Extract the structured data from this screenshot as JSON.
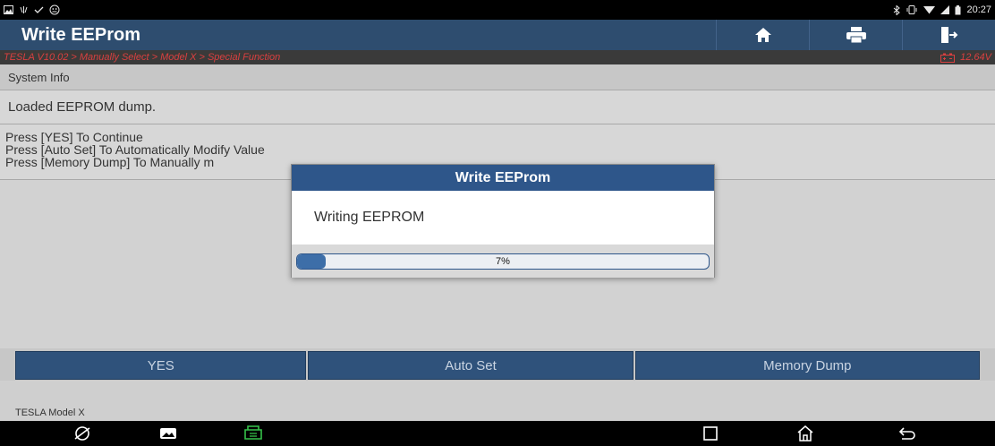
{
  "status_bar": {
    "time": "20:27",
    "left_icons": [
      "image-icon",
      "usb-icon",
      "check-icon",
      "android-icon"
    ],
    "right_icons": [
      "bluetooth-icon",
      "vibrate-icon",
      "wifi-icon",
      "signal-icon",
      "battery-icon"
    ]
  },
  "header": {
    "title": "Write EEProm",
    "buttons": [
      "home-icon",
      "print-icon",
      "exit-icon"
    ]
  },
  "breadcrumb": {
    "path": "TESLA V10.02 > Manually Select > Model X > Special Function",
    "voltage": "12.64V"
  },
  "section": {
    "title": "System Info"
  },
  "message": {
    "text": "Loaded EEPROM dump."
  },
  "instructions": {
    "line1": "Press [YES] To Continue",
    "line2": "Press [Auto Set] To Automatically Modify Value",
    "line3": "Press [Memory Dump] To Manually m"
  },
  "buttons": {
    "yes": "YES",
    "auto_set": "Auto Set",
    "memory_dump": "Memory Dump"
  },
  "footer": {
    "label": "TESLA Model X"
  },
  "dialog": {
    "title": "Write EEProm",
    "message": "Writing EEPROM",
    "progress_value": 7,
    "progress_text": "7%"
  },
  "colors": {
    "header_bg": "#2e4d6f",
    "dialog_title_bg": "#2e568a",
    "button_bg": "#2f527b",
    "breadcrumb_text": "#d94040",
    "progress_fill": "#3d6ea8"
  }
}
